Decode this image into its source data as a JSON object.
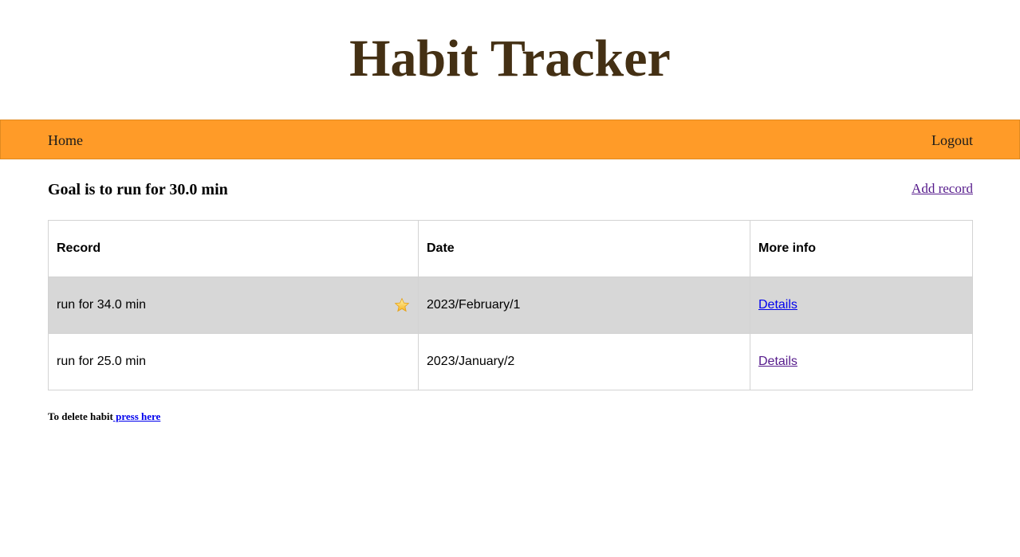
{
  "app": {
    "title": "Habit Tracker"
  },
  "nav": {
    "home_label": "Home",
    "logout_label": "Logout"
  },
  "goal": {
    "text": "Goal is to run for 30.0 min",
    "add_record_label": "Add record"
  },
  "table": {
    "headers": [
      "Record",
      "Date",
      "More info"
    ],
    "rows": [
      {
        "record": "run for 34.0 min",
        "date": "2023/February/1",
        "more_info": "Details",
        "goal_met_icon": "star-icon"
      },
      {
        "record": "run for 25.0 min",
        "date": "2023/January/2",
        "more_info": "Details"
      }
    ]
  },
  "delete": {
    "prefix": "To delete habit",
    "link_label": " press here"
  },
  "colors": {
    "title": "#443014",
    "navbar": "#ff9b28",
    "highlight_row": "#d7d7d7",
    "link": "#0000ee",
    "visited_link": "#551a8b"
  }
}
